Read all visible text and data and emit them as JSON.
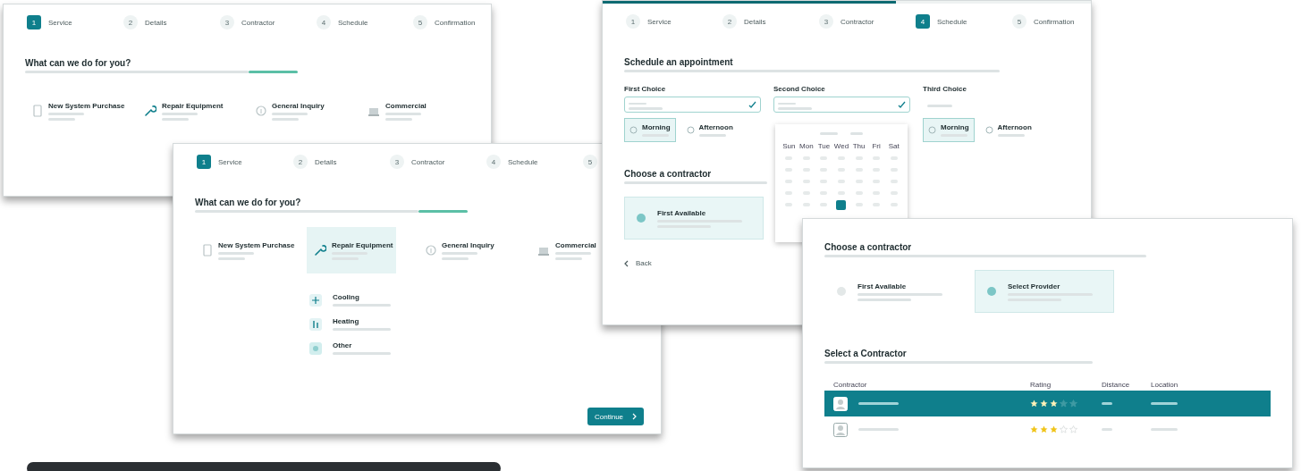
{
  "windows": [
    {
      "kind": "service",
      "steps": [
        {
          "number": "1",
          "label": "Service",
          "selected": true
        },
        {
          "number": "2",
          "label": "Details",
          "selected": false
        },
        {
          "number": "3",
          "label": "Contractor",
          "selected": false
        },
        {
          "number": "4",
          "label": "Schedule",
          "selected": false
        },
        {
          "number": "5",
          "label": "Confirmation",
          "selected": false
        }
      ],
      "heading": "What can we do for you?",
      "options": [
        {
          "title": "New System Purchase",
          "selected": false
        },
        {
          "title": "Repair Equipment",
          "selected": false
        },
        {
          "title": "General Inquiry",
          "selected": false
        },
        {
          "title": "Commercial",
          "selected": false
        }
      ]
    },
    {
      "kind": "service",
      "steps": [
        {
          "number": "1",
          "label": "Service",
          "selected": true
        },
        {
          "number": "2",
          "label": "Details",
          "selected": false
        },
        {
          "number": "3",
          "label": "Contractor",
          "selected": false
        },
        {
          "number": "4",
          "label": "Schedule",
          "selected": false
        },
        {
          "number": "5",
          "selected": false
        }
      ],
      "heading": "What can we do for you?",
      "options": [
        {
          "title": "New System Purchase",
          "selected": false
        },
        {
          "title": "Repair Equipment",
          "selected": true
        },
        {
          "title": "General Inquiry",
          "selected": false
        },
        {
          "title": "Commercial",
          "selected": false
        }
      ],
      "sub_options": [
        {
          "title": "Cooling"
        },
        {
          "title": "Heating"
        },
        {
          "title": "Other"
        }
      ],
      "button": "Continue"
    },
    {
      "kind": "schedule",
      "progress": {
        "level": 0.6
      },
      "steps": [
        {
          "number": "1",
          "label": "Service",
          "selected": false
        },
        {
          "number": "2",
          "label": "Details",
          "selected": false
        },
        {
          "number": "3",
          "label": "Contractor",
          "selected": false
        },
        {
          "number": "4",
          "label": "Schedule",
          "selected": true
        },
        {
          "number": "5",
          "label": "Confirmation",
          "selected": false
        }
      ],
      "heading": "Schedule an appointment",
      "choices": [
        {
          "label": "First Choice",
          "filled": true,
          "slots": [
            {
              "title": "Morning",
              "selected": true
            },
            {
              "title": "Afternoon",
              "selected": false
            }
          ]
        },
        {
          "label": "Second Choice",
          "filled": true
        },
        {
          "label": "Third Choice",
          "filled": false,
          "slots": [
            {
              "title": "Morning",
              "selected": true
            },
            {
              "title": "Afternoon",
              "selected": false
            }
          ]
        }
      ],
      "calendar": {
        "weekdays": [
          "Sun",
          "Mon",
          "Tue",
          "Wed",
          "Thu",
          "Fri",
          "Sat"
        ],
        "days": [
          {
            "selected": false
          },
          {
            "selected": false
          },
          {
            "selected": false
          },
          {
            "selected": false
          },
          {
            "selected": false
          },
          {
            "selected": false
          },
          {
            "selected": false
          },
          {
            "selected": false
          },
          {
            "selected": false
          },
          {
            "selected": false
          },
          {
            "selected": false
          },
          {
            "selected": false
          },
          {
            "selected": false
          },
          {
            "selected": false
          },
          {
            "selected": false
          },
          {
            "selected": false
          },
          {
            "selected": false
          },
          {
            "selected": false
          },
          {
            "selected": false
          },
          {
            "selected": false
          },
          {
            "selected": false
          },
          {
            "selected": false
          },
          {
            "selected": false
          },
          {
            "selected": false
          },
          {
            "selected": false
          },
          {
            "selected": false
          },
          {
            "selected": false
          },
          {
            "selected": false
          },
          {
            "selected": false
          },
          {
            "selected": false
          },
          {
            "selected": false
          },
          {
            "selected": true
          },
          {
            "selected": false
          },
          {
            "selected": false
          },
          {
            "selected": false
          }
        ]
      },
      "contractor_heading": "Choose a contractor",
      "contractor_options": [
        {
          "title": "First Available",
          "selected": true
        }
      ],
      "back": "Back"
    },
    {
      "kind": "contractor",
      "heading": "Choose a contractor",
      "contractor_options": [
        {
          "title": "First Available",
          "selected": false
        },
        {
          "title": "Select Provider",
          "selected": true
        }
      ],
      "table_heading": "Select a Contractor",
      "columns": [
        "Contractor",
        "Rating",
        "Distance",
        "Location"
      ],
      "rows": [
        {
          "selected": true,
          "stars": 3
        },
        {
          "selected": false,
          "stars": 3
        }
      ]
    }
  ]
}
